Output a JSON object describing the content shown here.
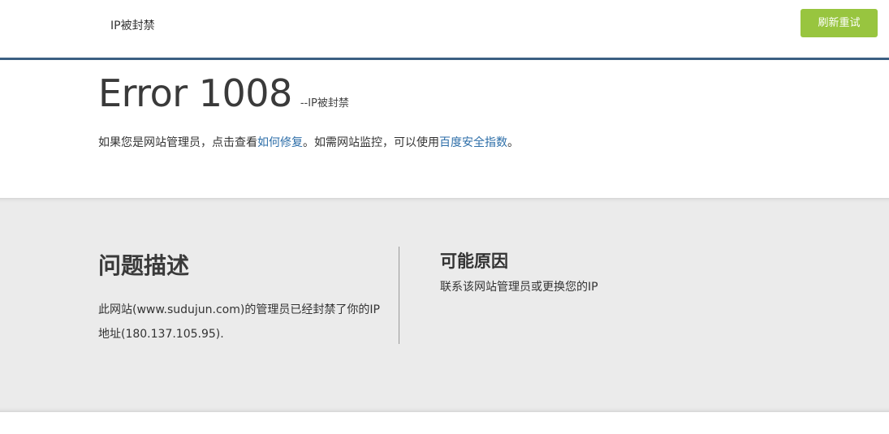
{
  "header": {
    "title": "IP被封禁",
    "refresh_label": "刷新重试"
  },
  "error": {
    "code": "Error 1008",
    "subtitle": "--IP被封禁"
  },
  "description": {
    "text_before": "如果您是网站管理员，点击查看",
    "fix_link": "如何修复",
    "text_middle": "。如需网站监控，可以使用",
    "index_link": "百度安全指数",
    "text_after": "。"
  },
  "problem": {
    "title": "问题描述",
    "text": "此网站(www.sudujun.com)的管理员已经封禁了你的IP地址(180.137.105.95)."
  },
  "cause": {
    "title": "可能原因",
    "text": "联系该网站管理员或更换您的IP"
  },
  "colors": {
    "header_border": "#3b5f82",
    "button": "#98c53f",
    "link": "#2d6ea8",
    "band": "#ebebeb"
  }
}
